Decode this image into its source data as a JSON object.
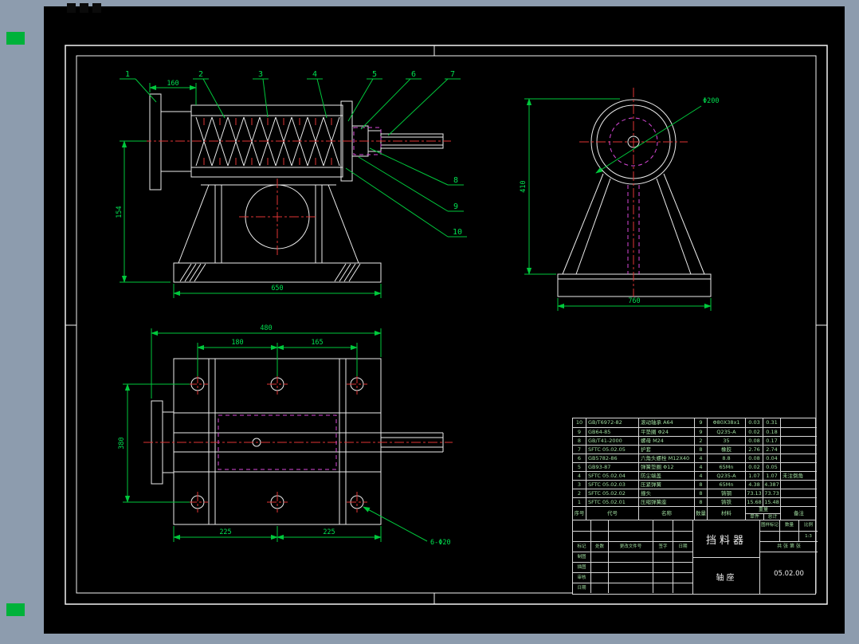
{
  "window": {
    "bg": "#8d9cae",
    "canvas_bg": "#000000",
    "geometry_color": "#ececec",
    "dimension_color": "#00c83c",
    "centerline_color": "#e03434",
    "hidden_color": "#d848d8"
  },
  "callouts": {
    "labels": [
      "1",
      "2",
      "3",
      "4",
      "5",
      "6",
      "7",
      "8",
      "9",
      "10"
    ]
  },
  "front_view": {
    "dim_top": "160",
    "dim_left": "154",
    "dim_bottom": "650"
  },
  "side_view": {
    "dim_dia": "Φ200",
    "dim_height": "410",
    "dim_width": "760"
  },
  "plan_view": {
    "dim_total": "480",
    "dim_a": "180",
    "dim_b": "165",
    "dim_left": "380",
    "dim_c": "225",
    "dim_d": "225",
    "holes": "6-Φ20"
  },
  "bom": {
    "header": {
      "no": "序号",
      "code": "代号",
      "name": "名称",
      "qty": "数量",
      "material": "材料",
      "weight": "重量",
      "single": "单件",
      "total": "总计",
      "remark": "备注"
    },
    "rows": [
      [
        "10",
        "GB/T6972-82",
        "滚动轴承 A64",
        "9",
        "Φ80X38x1",
        "0.03",
        "0.31",
        ""
      ],
      [
        "9",
        "GB64-85",
        "平垫圈 Φ24",
        "9",
        "Q235-A",
        "0.02",
        "0.18",
        ""
      ],
      [
        "8",
        "GB/T41-2000",
        "螺母 M24",
        "2",
        "35",
        "0.08",
        "0.17",
        ""
      ],
      [
        "7",
        "SFTC 05.02.05",
        "护套",
        "8",
        "橡胶",
        "2.76",
        "2.74",
        ""
      ],
      [
        "6",
        "GB5782-86",
        "六角头螺栓 M12X40",
        "4",
        "8.8",
        "0.08",
        "0.04",
        ""
      ],
      [
        "5",
        "GB93-87",
        "弹簧垫圈 Φ12",
        "4",
        "65Mn",
        "0.02",
        "0.05",
        ""
      ],
      [
        "4",
        "SFTC 05.02.04",
        "防尘端盖",
        "4",
        "Q235-A",
        "1.07",
        "1.07",
        "未注倒角"
      ],
      [
        "3",
        "SFTC 05.02.03",
        "压紧弹簧",
        "8",
        "65Mn",
        "4.38",
        "4.387",
        ""
      ],
      [
        "2",
        "SFTC 05.02.02",
        "撞头",
        "8",
        "铸钢",
        "73.13",
        "73.73",
        ""
      ],
      [
        "1",
        "SFTC 05.02.01",
        "压缩弹簧座",
        "8",
        "铸铁",
        "15.68",
        "15.48",
        ""
      ]
    ]
  },
  "title_block": {
    "part_name": "挡料器",
    "sub_name": "轴座",
    "rev_headers": [
      "标记",
      "处数",
      "更改文件号",
      "签字",
      "日期"
    ],
    "sig_labels": [
      "制图",
      "描图",
      "审核",
      "日期"
    ],
    "mark_label": "图样标记",
    "qty_label": "数量",
    "scale_label": "比例",
    "scale": "1:3",
    "sheet": "共 张 第 张",
    "drawing_no": "05.02.00"
  }
}
